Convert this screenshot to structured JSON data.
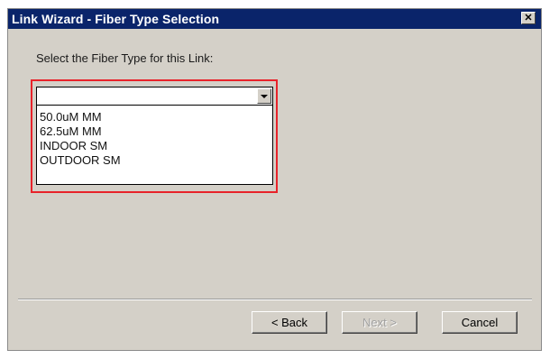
{
  "window": {
    "title": "Link Wizard - Fiber Type Selection",
    "close_glyph": "✕"
  },
  "prompt": "Select the Fiber Type for this Link:",
  "combo": {
    "selected_value": "",
    "options": [
      "50.0uM MM",
      "62.5uM MM",
      "INDOOR SM",
      "OUTDOOR SM"
    ]
  },
  "buttons": {
    "back": "< Back",
    "next": "Next >",
    "cancel": "Cancel"
  },
  "colors": {
    "titlebar": "#0a246a",
    "highlight": "#e8232a",
    "dialog_bg": "#d4d0c8"
  }
}
